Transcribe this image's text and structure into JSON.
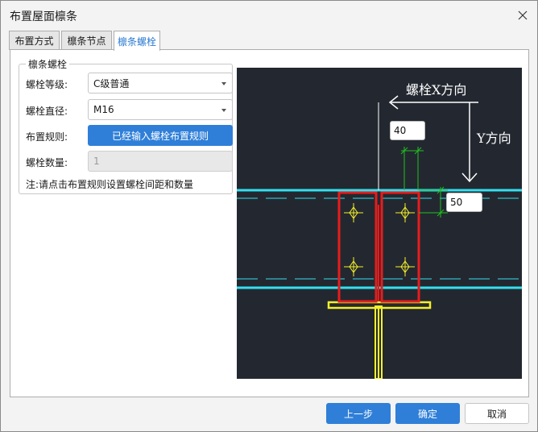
{
  "window": {
    "title": "布置屋面檩条"
  },
  "tabs": [
    {
      "label": "布置方式",
      "active": false
    },
    {
      "label": "檩条节点",
      "active": false
    },
    {
      "label": "檩条螺栓",
      "active": true
    }
  ],
  "group": {
    "title": "檩条螺栓",
    "grade_label": "螺栓等级:",
    "grade_value": "C级普通",
    "diameter_label": "螺栓直径:",
    "diameter_value": "M16",
    "rule_label": "布置规则:",
    "rule_button": "已经输入螺栓布置规则",
    "count_label": "螺栓数量:",
    "count_value": "1",
    "note": "注:请点击布置规则设置螺栓间距和数量"
  },
  "preview": {
    "x_direction_label": "螺栓X方向",
    "y_direction_label": "Y方向",
    "dim_top_value": "40",
    "dim_side_value": "50",
    "colors": {
      "background": "#232830",
      "purlin": "#33e0f0",
      "plate": "#e81c1c",
      "beam": "#f5f02a",
      "bolt": "#f5f02a",
      "dimension": "#21c021",
      "arrow": "#ffffff"
    }
  },
  "footer": {
    "prev_label": "上一步",
    "ok_label": "确定",
    "cancel_label": "取消"
  }
}
